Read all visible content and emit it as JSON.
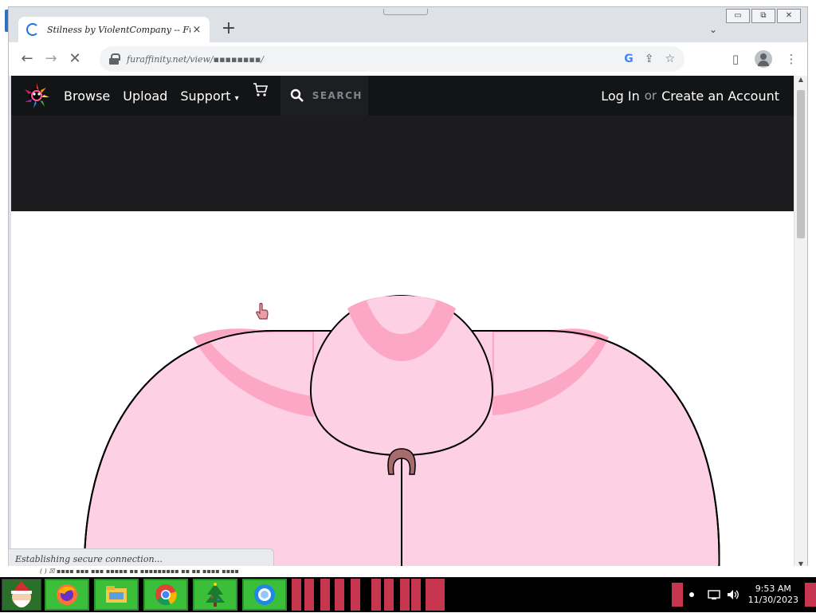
{
  "browser": {
    "tab": {
      "title": "Stilness by ViolentCompany -- Fur Affi",
      "close_label": "×"
    },
    "new_tab_label": "+",
    "tab_search_label": "⌄",
    "window_buttons": [
      "▭",
      "⧉",
      "✕"
    ],
    "toolbar": {
      "back_label": "←",
      "forward_label": "→",
      "reload_label": "✕",
      "url": "furaffinity.net/view/▪▪▪▪▪▪▪▪/",
      "google_label": "G",
      "share_label": "⇪",
      "bookmark_label": "☆",
      "sidepanel_label": "▯",
      "menu_label": "⋮"
    },
    "status_text": "Establishing secure connection..."
  },
  "site": {
    "nav": {
      "browse_label": "Browse",
      "upload_label": "Upload",
      "support_label": "Support",
      "support_caret": "▾",
      "search_placeholder": "SEARCH",
      "login_label": "Log In",
      "or_label": "or",
      "create_account_label": "Create an Account"
    },
    "colors": {
      "nav_bg": "#131415",
      "banner_bg": "#1c1c1e",
      "art_pink": "#fdd0e3",
      "art_pink_dark": "#fca8c4",
      "art_clip": "#a86b6d"
    }
  },
  "behind_window_text": "( ) ☒ ▪▪▪▪ ▪▪▪ ▪▪▪ ▪▪▪▪▪ ▪▪ ▪▪▪▪▪▪▪▪▪ ▪▪ ▪▪ ▪▪▪▪ ▪▪▪▪",
  "taskbar": {
    "apps": [
      "start-menu",
      "firefox",
      "file-explorer",
      "chrome",
      "christmas-tree",
      "messenger"
    ],
    "clock_time": "9:53 AM",
    "clock_date": "11/30/2023"
  }
}
